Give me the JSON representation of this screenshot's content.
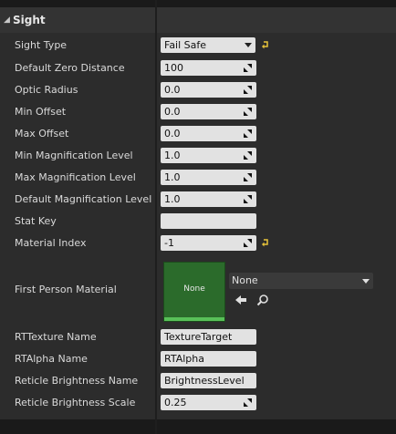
{
  "section": {
    "title": "Sight"
  },
  "rows": [
    {
      "label": "Sight Type",
      "value": "Fail Safe"
    },
    {
      "label": "Default Zero Distance",
      "value": "100"
    },
    {
      "label": "Optic Radius",
      "value": "0.0"
    },
    {
      "label": "Min Offset",
      "value": "0.0"
    },
    {
      "label": "Max Offset",
      "value": "0.0"
    },
    {
      "label": "Min Magnification Level",
      "value": "1.0"
    },
    {
      "label": "Max Magnification Level",
      "value": "1.0"
    },
    {
      "label": "Default Magnification Level",
      "value": "1.0"
    },
    {
      "label": "Stat Key",
      "value": ""
    },
    {
      "label": "Material Index",
      "value": "-1"
    },
    {
      "label": "First Person Material",
      "thumbnail": "None",
      "selected": "None"
    },
    {
      "label": "RTTexture Name",
      "value": "TextureTarget"
    },
    {
      "label": "RTAlpha Name",
      "value": "RTAlpha"
    },
    {
      "label": "Reticle Brightness Name",
      "value": "BrightnessLevel"
    },
    {
      "label": "Reticle Brightness Scale",
      "value": "0.25"
    }
  ],
  "icons": {
    "collapse": "triangle-down-icon",
    "reset": "reset-arrow-icon",
    "spin": "spin-arrows-icon",
    "use_selected": "left-arrow-icon",
    "browse": "search-icon"
  },
  "colors": {
    "panel": "#2c2c2c",
    "field": "#e2e2e2",
    "thumbnail": "#2b6b2b",
    "reset_icon": "#e8c33a"
  }
}
